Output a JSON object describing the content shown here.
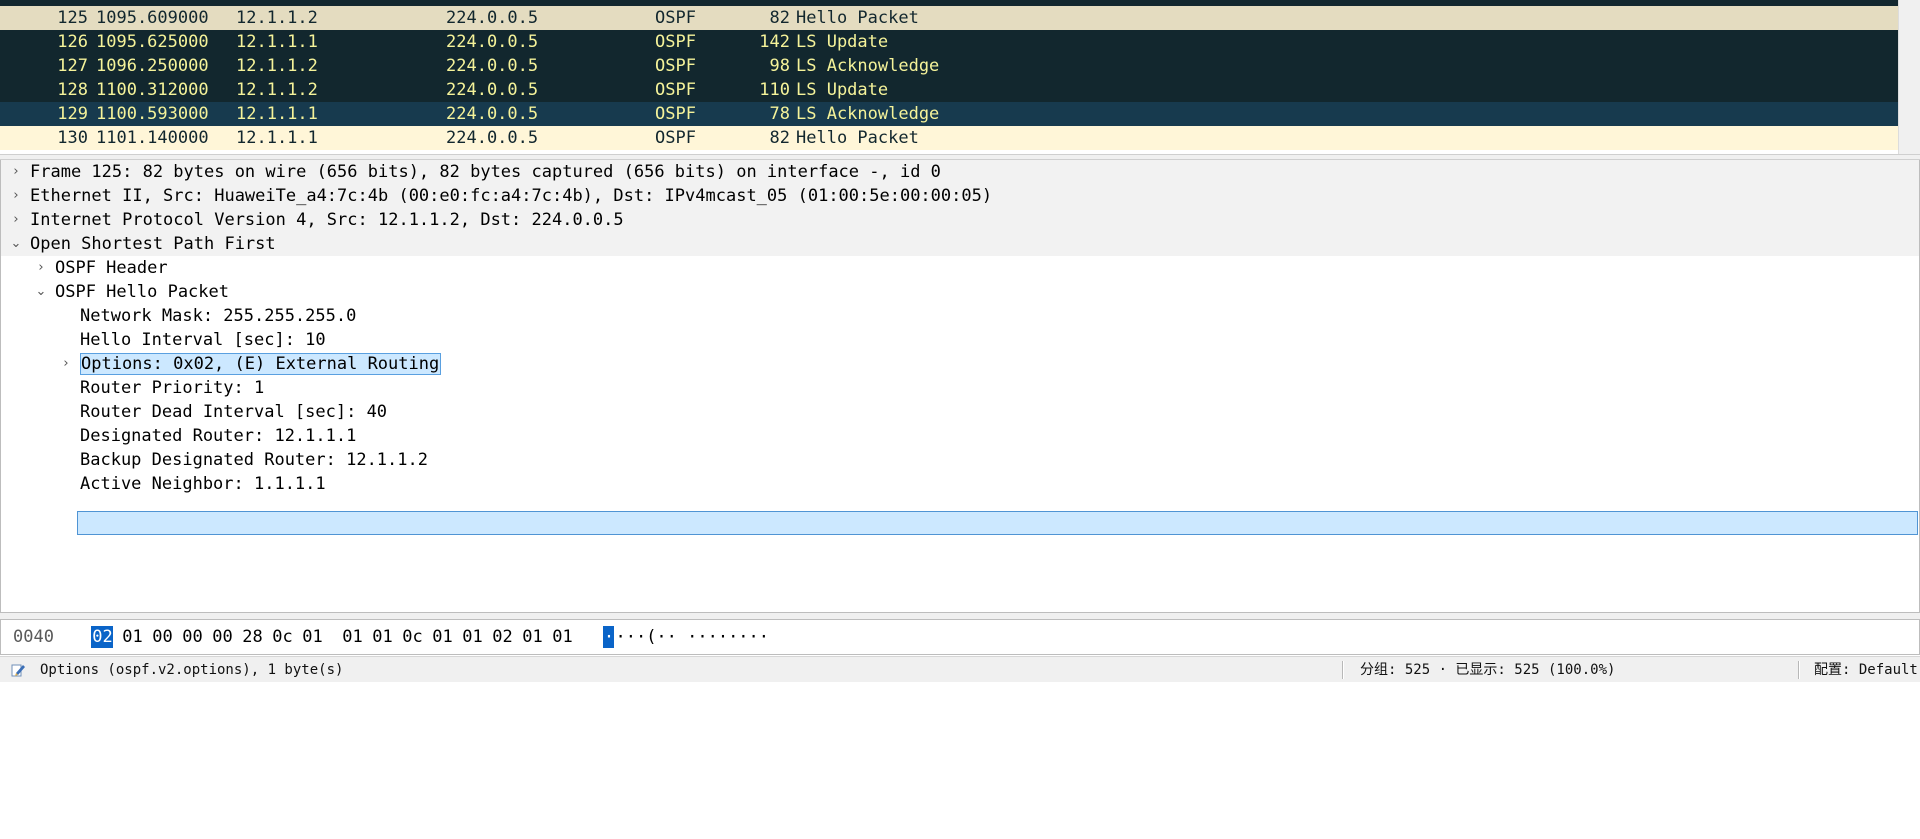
{
  "packet_list": {
    "rows": [
      {
        "no": "125",
        "time": "1095.609000",
        "src": "12.1.1.2",
        "dst": "224.0.0.5",
        "proto": "OSPF",
        "len": "82",
        "info": "Hello Packet"
      },
      {
        "no": "126",
        "time": "1095.625000",
        "src": "12.1.1.1",
        "dst": "224.0.0.5",
        "proto": "OSPF",
        "len": "142",
        "info": "LS Update"
      },
      {
        "no": "127",
        "time": "1096.250000",
        "src": "12.1.1.2",
        "dst": "224.0.0.5",
        "proto": "OSPF",
        "len": "98",
        "info": "LS Acknowledge"
      },
      {
        "no": "128",
        "time": "1100.312000",
        "src": "12.1.1.2",
        "dst": "224.0.0.5",
        "proto": "OSPF",
        "len": "110",
        "info": "LS Update"
      },
      {
        "no": "129",
        "time": "1100.593000",
        "src": "12.1.1.1",
        "dst": "224.0.0.5",
        "proto": "OSPF",
        "len": "78",
        "info": "LS Acknowledge"
      },
      {
        "no": "130",
        "time": "1101.140000",
        "src": "12.1.1.1",
        "dst": "224.0.0.5",
        "proto": "OSPF",
        "len": "82",
        "info": "Hello Packet"
      }
    ],
    "row_colors": {
      "hello_bg": "#e4dcc0",
      "hello_fg": "#12272e",
      "dark_bg": "#12272e",
      "dark_fg": "#f5f39a",
      "last_bg": "#fff6d8"
    }
  },
  "details": {
    "items": [
      {
        "text": "Frame 125: 82 bytes on wire (656 bits), 82 bytes captured (656 bits) on interface -, id 0",
        "arrow": "›"
      },
      {
        "text": "Ethernet II, Src: HuaweiTe_a4:7c:4b (00:e0:fc:a4:7c:4b), Dst: IPv4mcast_05 (01:00:5e:00:00:05)",
        "arrow": "›"
      },
      {
        "text": "Internet Protocol Version 4, Src: 12.1.1.2, Dst: 224.0.0.5",
        "arrow": "›"
      },
      {
        "text": "Open Shortest Path First",
        "arrow": "⌄"
      },
      {
        "text": "OSPF Header",
        "arrow": "›"
      },
      {
        "text": "OSPF Hello Packet",
        "arrow": "⌄"
      },
      {
        "text": "Network Mask: 255.255.255.0",
        "arrow": ""
      },
      {
        "text": "Hello Interval [sec]: 10",
        "arrow": ""
      },
      {
        "text": "Options: 0x02, (E) External Routing",
        "arrow": "›"
      },
      {
        "text": "Router Priority: 1",
        "arrow": ""
      },
      {
        "text": "Router Dead Interval [sec]: 40",
        "arrow": ""
      },
      {
        "text": "Designated Router: 12.1.1.1",
        "arrow": ""
      },
      {
        "text": "Backup Designated Router: 12.1.1.2",
        "arrow": ""
      },
      {
        "text": "Active Neighbor: 1.1.1.1",
        "arrow": ""
      }
    ],
    "highlight_color": "#e8201c",
    "selection_color": "#cce8ff"
  },
  "bytes": {
    "offset": "0040",
    "hex": [
      "02",
      "01",
      "00",
      "00",
      "00",
      "28",
      "0c",
      "01",
      "01",
      "01",
      "0c",
      "01",
      "01",
      "02",
      "01",
      "01"
    ],
    "ascii_selected": "·",
    "ascii_rest": "···(·· ········",
    "selected_color": "#0a64c8"
  },
  "status": {
    "field_info": "Options (ospf.v2.options), 1 byte(s)",
    "packets": "分组: 525 · 已显示: 525 (100.0%)",
    "profile": "配置: Default",
    "icon": "edit-icon"
  }
}
